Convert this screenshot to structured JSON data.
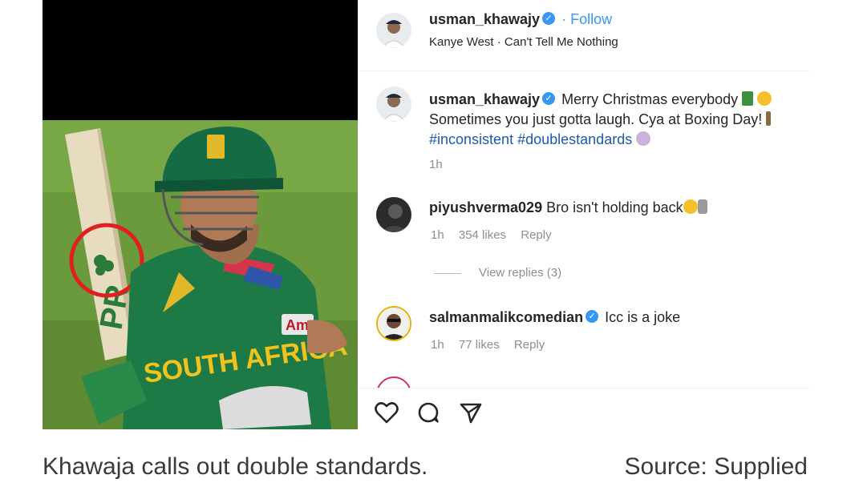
{
  "post": {
    "author": "usman_khawajy",
    "follow_label": "Follow",
    "separator": "·",
    "audio": "Kanye West · Can't Tell Me Nothing",
    "caption_line1": "Merry Christmas everybody",
    "caption_line2": "Sometimes you just gotta laugh. Cya at Boxing Day!",
    "hashtag1": "#inconsistent",
    "hashtag2": "#doublestandards",
    "caption_time": "1h"
  },
  "photo": {
    "bat_text": "PR",
    "shirt_text": "SOUTH AFRICA",
    "sponsor_text": "Am"
  },
  "comments": [
    {
      "username": "piyushverma029",
      "text": "Bro isn't holding back",
      "time": "1h",
      "likes": "354 likes",
      "reply": "Reply"
    },
    {
      "username": "salmanmalikcomedian",
      "text": "Icc is a joke",
      "time": "1h",
      "likes": "77 likes",
      "reply": "Reply"
    }
  ],
  "view_replies": "View replies (3)",
  "icons": [
    "heart-icon",
    "comment-icon",
    "share-icon",
    "verified-badge-icon"
  ],
  "colors": {
    "verified": "#3897f0",
    "link": "#1e5aa8",
    "highlight_circle": "#e02020"
  },
  "footer": {
    "caption": "Khawaja calls out double standards.",
    "source": "Source: Supplied"
  }
}
